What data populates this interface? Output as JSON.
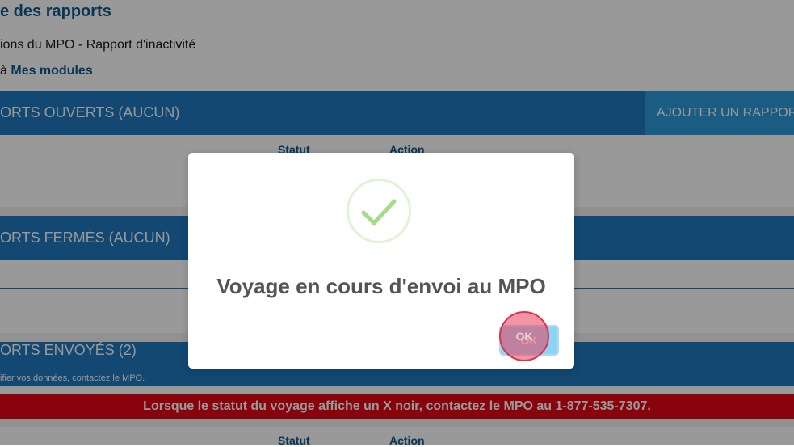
{
  "page": {
    "title": "e des rapports",
    "subtitle": "ions du MPO - Rapport d'inactivité",
    "back_prefix": "à",
    "back_link": "Mes modules"
  },
  "sections": {
    "open": {
      "title": "ORTS OUVERTS (AUCUN)",
      "add_button": "AJOUTER UN RAPPORT"
    },
    "closed": {
      "title": "ORTS FERMÉS (AUCUN)"
    },
    "sent": {
      "title": "ORTS ENVOYÉS (2)",
      "note": "ifier vos données, contactez le MPO."
    }
  },
  "table": {
    "col_status": "Statut",
    "col_action": "Action"
  },
  "alert": {
    "text": "Lorsque le statut du voyage affiche un X noir, contactez le MPO au 1-877-535-7307."
  },
  "modal": {
    "icon": "success-check-icon",
    "message": "Voyage en cours d'envoi au MPO",
    "ok_label": "OK"
  },
  "colors": {
    "header_blue": "#1e79bd",
    "add_button_blue": "#2d9ad9",
    "alert_red": "#e30613",
    "check_green": "#a5dc86",
    "ok_blue": "#8cd4f5"
  }
}
